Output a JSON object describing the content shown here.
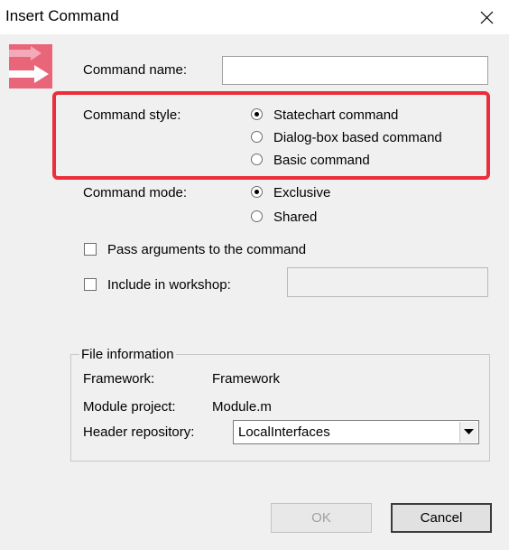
{
  "window": {
    "title": "Insert Command"
  },
  "colors": {
    "highlight": "#ec2e3a",
    "icon_pink": "#e8657a",
    "icon_bg": "#f4a9b8"
  },
  "icons": {
    "app": "insert-command-arrow-icon",
    "close": "close-icon"
  },
  "form": {
    "command_name": {
      "label": "Command name:",
      "value": ""
    },
    "command_style": {
      "label": "Command style:",
      "options": [
        {
          "label": "Statechart command",
          "selected": true
        },
        {
          "label": "Dialog-box based command",
          "selected": false
        },
        {
          "label": "Basic command",
          "selected": false
        }
      ]
    },
    "command_mode": {
      "label": "Command mode:",
      "options": [
        {
          "label": "Exclusive",
          "selected": true
        },
        {
          "label": "Shared",
          "selected": false
        }
      ]
    },
    "pass_arguments": {
      "label": "Pass arguments to the command",
      "checked": false
    },
    "include_workshop": {
      "label": "Include in workshop:",
      "checked": false,
      "value": ""
    }
  },
  "file_info": {
    "legend": "File information",
    "framework_label": "Framework:",
    "framework_value": "Framework",
    "module_label": "Module project:",
    "module_value": "Module.m",
    "header_label": "Header repository:",
    "header_value": "LocalInterfaces"
  },
  "buttons": {
    "ok": "OK",
    "cancel": "Cancel"
  }
}
